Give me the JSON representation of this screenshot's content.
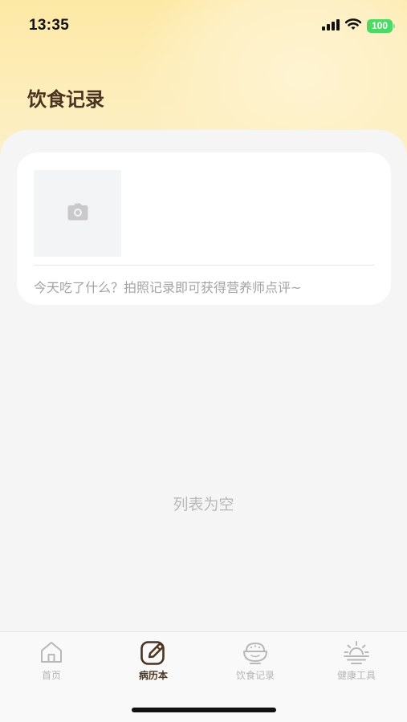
{
  "status_bar": {
    "time": "13:35",
    "battery": "100",
    "icons": [
      "cellular-signal-icon",
      "wifi-icon",
      "battery-icon"
    ]
  },
  "page": {
    "title": "饮食记录"
  },
  "post_card": {
    "photo_icon": "camera-icon",
    "prompt": "今天吃了什么？拍照记录即可获得营养师点评~"
  },
  "list": {
    "empty_text": "列表为空"
  },
  "tab_bar": {
    "tabs": [
      {
        "label": "首页",
        "icon": "home-icon",
        "active": false
      },
      {
        "label": "病历本",
        "icon": "edit-note-icon",
        "active": true
      },
      {
        "label": "饮食记录",
        "icon": "rice-bowl-icon",
        "active": false
      },
      {
        "label": "健康工具",
        "icon": "sunrise-icon",
        "active": false
      }
    ]
  },
  "colors": {
    "header_gradient_top": "#fde9a6",
    "title_brown": "#4a3320",
    "battery_green": "#4cd964",
    "inactive_gray": "#b5b5b5"
  }
}
